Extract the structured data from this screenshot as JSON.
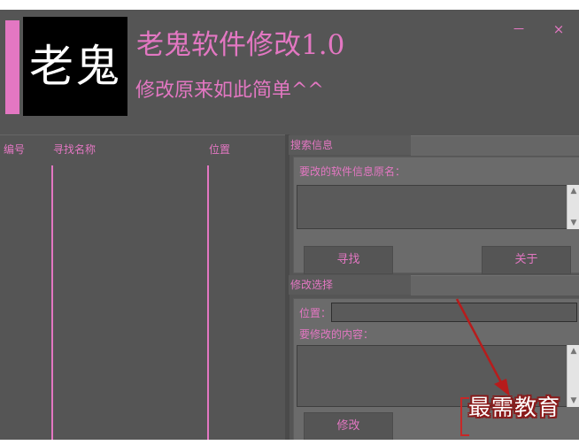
{
  "window": {
    "logo_text": "老鬼",
    "title": "老鬼软件修改1.0",
    "subtitle": "修改原来如此简单^^",
    "minimize_label": "－",
    "close_label": "×"
  },
  "results_table": {
    "columns": [
      "编号",
      "寻找名称",
      "位置"
    ],
    "rows": []
  },
  "search_section": {
    "tab_label": "搜索信息",
    "original_name_label": "要改的软件信息原名：",
    "original_name_value": "",
    "find_button": "寻找",
    "about_button": "关于"
  },
  "modify_section": {
    "tab_label": "修改选择",
    "position_label": "位置：",
    "position_value": "",
    "content_label": "要修改的内容：",
    "content_value": "",
    "modify_button": "修改"
  },
  "watermark": "最需教育",
  "colors": {
    "accent": "#e377c2",
    "background": "#555555",
    "panel": "#6b6b6b",
    "annotation_arrow": "#b71c1c"
  },
  "icons": {
    "scroll_up": "chevron-up-icon",
    "scroll_down": "chevron-down-icon",
    "annotation": "red-arrow-icon"
  }
}
